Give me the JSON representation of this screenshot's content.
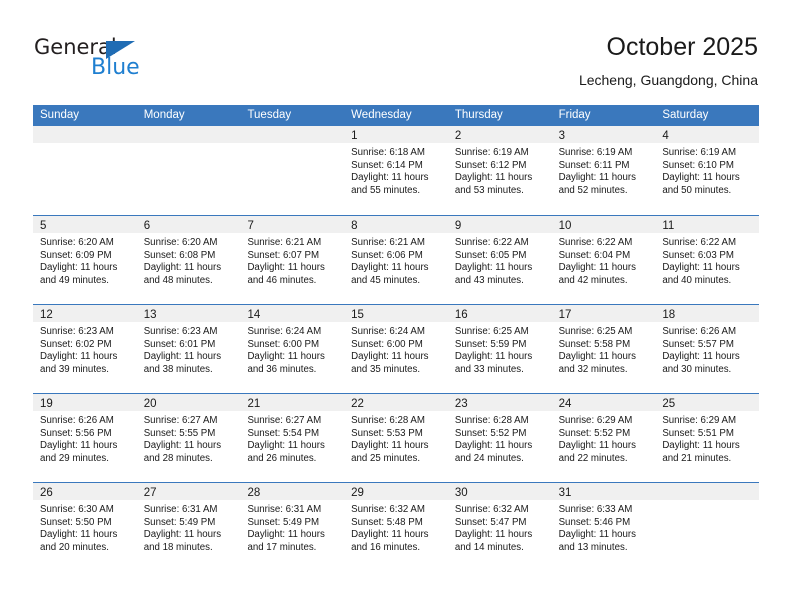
{
  "brand": {
    "name_part1": "General",
    "name_part2": "Blue",
    "triangle_color": "#1f6cb4",
    "blue_color": "#1f7fd0"
  },
  "header": {
    "title": "October 2025",
    "location": "Lecheng, Guangdong, China"
  },
  "theme": {
    "header_row_bg": "#3a78bd",
    "day_band_bg": "#f0f0f0",
    "cell_bg": "#ffffff",
    "text_color": "#1a1a1a"
  },
  "weekdays": [
    "Sunday",
    "Monday",
    "Tuesday",
    "Wednesday",
    "Thursday",
    "Friday",
    "Saturday"
  ],
  "weeks": [
    [
      {
        "day": "",
        "empty": true
      },
      {
        "day": "",
        "empty": true
      },
      {
        "day": "",
        "empty": true
      },
      {
        "day": "1",
        "sunrise": "Sunrise: 6:18 AM",
        "sunset": "Sunset: 6:14 PM",
        "daylight": "Daylight: 11 hours and 55 minutes."
      },
      {
        "day": "2",
        "sunrise": "Sunrise: 6:19 AM",
        "sunset": "Sunset: 6:12 PM",
        "daylight": "Daylight: 11 hours and 53 minutes."
      },
      {
        "day": "3",
        "sunrise": "Sunrise: 6:19 AM",
        "sunset": "Sunset: 6:11 PM",
        "daylight": "Daylight: 11 hours and 52 minutes."
      },
      {
        "day": "4",
        "sunrise": "Sunrise: 6:19 AM",
        "sunset": "Sunset: 6:10 PM",
        "daylight": "Daylight: 11 hours and 50 minutes."
      }
    ],
    [
      {
        "day": "5",
        "sunrise": "Sunrise: 6:20 AM",
        "sunset": "Sunset: 6:09 PM",
        "daylight": "Daylight: 11 hours and 49 minutes."
      },
      {
        "day": "6",
        "sunrise": "Sunrise: 6:20 AM",
        "sunset": "Sunset: 6:08 PM",
        "daylight": "Daylight: 11 hours and 48 minutes."
      },
      {
        "day": "7",
        "sunrise": "Sunrise: 6:21 AM",
        "sunset": "Sunset: 6:07 PM",
        "daylight": "Daylight: 11 hours and 46 minutes."
      },
      {
        "day": "8",
        "sunrise": "Sunrise: 6:21 AM",
        "sunset": "Sunset: 6:06 PM",
        "daylight": "Daylight: 11 hours and 45 minutes."
      },
      {
        "day": "9",
        "sunrise": "Sunrise: 6:22 AM",
        "sunset": "Sunset: 6:05 PM",
        "daylight": "Daylight: 11 hours and 43 minutes."
      },
      {
        "day": "10",
        "sunrise": "Sunrise: 6:22 AM",
        "sunset": "Sunset: 6:04 PM",
        "daylight": "Daylight: 11 hours and 42 minutes."
      },
      {
        "day": "11",
        "sunrise": "Sunrise: 6:22 AM",
        "sunset": "Sunset: 6:03 PM",
        "daylight": "Daylight: 11 hours and 40 minutes."
      }
    ],
    [
      {
        "day": "12",
        "sunrise": "Sunrise: 6:23 AM",
        "sunset": "Sunset: 6:02 PM",
        "daylight": "Daylight: 11 hours and 39 minutes."
      },
      {
        "day": "13",
        "sunrise": "Sunrise: 6:23 AM",
        "sunset": "Sunset: 6:01 PM",
        "daylight": "Daylight: 11 hours and 38 minutes."
      },
      {
        "day": "14",
        "sunrise": "Sunrise: 6:24 AM",
        "sunset": "Sunset: 6:00 PM",
        "daylight": "Daylight: 11 hours and 36 minutes."
      },
      {
        "day": "15",
        "sunrise": "Sunrise: 6:24 AM",
        "sunset": "Sunset: 6:00 PM",
        "daylight": "Daylight: 11 hours and 35 minutes."
      },
      {
        "day": "16",
        "sunrise": "Sunrise: 6:25 AM",
        "sunset": "Sunset: 5:59 PM",
        "daylight": "Daylight: 11 hours and 33 minutes."
      },
      {
        "day": "17",
        "sunrise": "Sunrise: 6:25 AM",
        "sunset": "Sunset: 5:58 PM",
        "daylight": "Daylight: 11 hours and 32 minutes."
      },
      {
        "day": "18",
        "sunrise": "Sunrise: 6:26 AM",
        "sunset": "Sunset: 5:57 PM",
        "daylight": "Daylight: 11 hours and 30 minutes."
      }
    ],
    [
      {
        "day": "19",
        "sunrise": "Sunrise: 6:26 AM",
        "sunset": "Sunset: 5:56 PM",
        "daylight": "Daylight: 11 hours and 29 minutes."
      },
      {
        "day": "20",
        "sunrise": "Sunrise: 6:27 AM",
        "sunset": "Sunset: 5:55 PM",
        "daylight": "Daylight: 11 hours and 28 minutes."
      },
      {
        "day": "21",
        "sunrise": "Sunrise: 6:27 AM",
        "sunset": "Sunset: 5:54 PM",
        "daylight": "Daylight: 11 hours and 26 minutes."
      },
      {
        "day": "22",
        "sunrise": "Sunrise: 6:28 AM",
        "sunset": "Sunset: 5:53 PM",
        "daylight": "Daylight: 11 hours and 25 minutes."
      },
      {
        "day": "23",
        "sunrise": "Sunrise: 6:28 AM",
        "sunset": "Sunset: 5:52 PM",
        "daylight": "Daylight: 11 hours and 24 minutes."
      },
      {
        "day": "24",
        "sunrise": "Sunrise: 6:29 AM",
        "sunset": "Sunset: 5:52 PM",
        "daylight": "Daylight: 11 hours and 22 minutes."
      },
      {
        "day": "25",
        "sunrise": "Sunrise: 6:29 AM",
        "sunset": "Sunset: 5:51 PM",
        "daylight": "Daylight: 11 hours and 21 minutes."
      }
    ],
    [
      {
        "day": "26",
        "sunrise": "Sunrise: 6:30 AM",
        "sunset": "Sunset: 5:50 PM",
        "daylight": "Daylight: 11 hours and 20 minutes."
      },
      {
        "day": "27",
        "sunrise": "Sunrise: 6:31 AM",
        "sunset": "Sunset: 5:49 PM",
        "daylight": "Daylight: 11 hours and 18 minutes."
      },
      {
        "day": "28",
        "sunrise": "Sunrise: 6:31 AM",
        "sunset": "Sunset: 5:49 PM",
        "daylight": "Daylight: 11 hours and 17 minutes."
      },
      {
        "day": "29",
        "sunrise": "Sunrise: 6:32 AM",
        "sunset": "Sunset: 5:48 PM",
        "daylight": "Daylight: 11 hours and 16 minutes."
      },
      {
        "day": "30",
        "sunrise": "Sunrise: 6:32 AM",
        "sunset": "Sunset: 5:47 PM",
        "daylight": "Daylight: 11 hours and 14 minutes."
      },
      {
        "day": "31",
        "sunrise": "Sunrise: 6:33 AM",
        "sunset": "Sunset: 5:46 PM",
        "daylight": "Daylight: 11 hours and 13 minutes."
      },
      {
        "day": "",
        "empty": true
      }
    ]
  ]
}
